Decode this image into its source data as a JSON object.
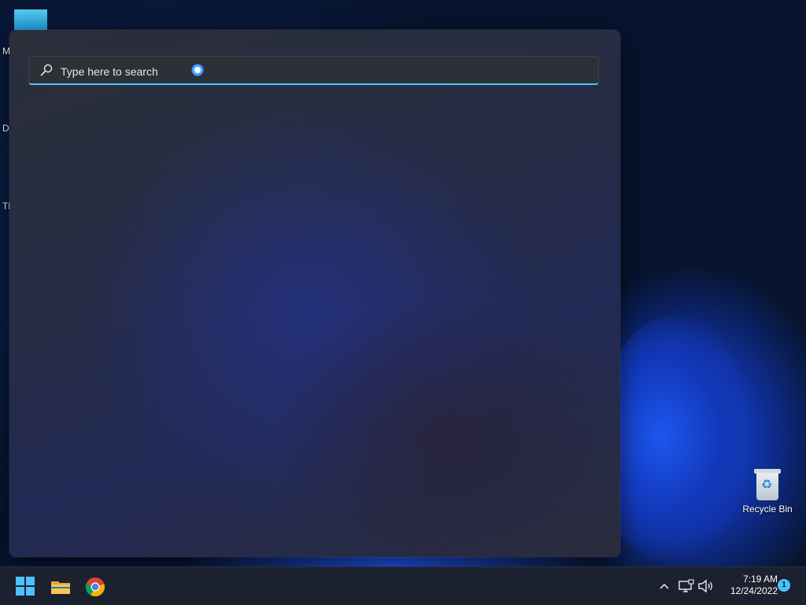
{
  "desktop": {
    "left_labels": [
      "M",
      "D",
      "Th"
    ],
    "recycle_bin_label": "Recycle Bin"
  },
  "search": {
    "placeholder": "Type here to search",
    "icon": "search-icon",
    "assistant_icon": "cortana-icon",
    "accent_color": "#4cc2ff"
  },
  "taskbar": {
    "pinned": [
      {
        "name": "start-button",
        "icon": "windows-logo-icon"
      },
      {
        "name": "file-explorer",
        "icon": "folder-icon"
      },
      {
        "name": "google-chrome",
        "icon": "chrome-icon"
      }
    ],
    "tray": {
      "time": "7:19 AM",
      "date": "12/24/2022",
      "notification_count": "1"
    }
  }
}
